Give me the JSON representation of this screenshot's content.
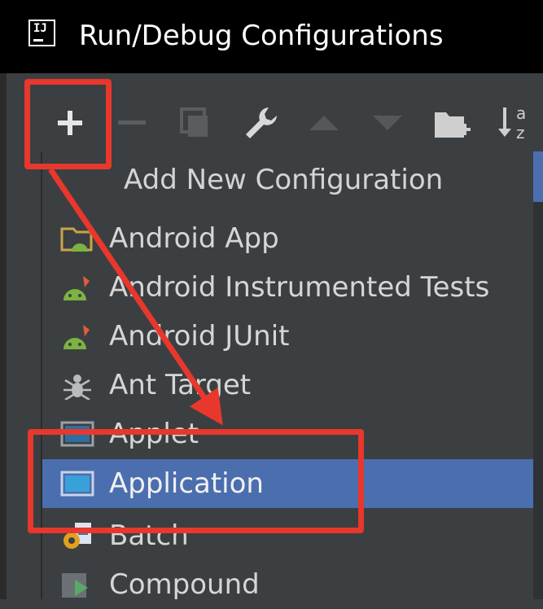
{
  "window": {
    "app_icon_text": "IJ",
    "title": "Run/Debug Configurations"
  },
  "toolbar": {
    "buttons": [
      {
        "name": "add",
        "icon": "plus-icon",
        "enabled": true
      },
      {
        "name": "remove",
        "icon": "minus-icon",
        "enabled": false
      },
      {
        "name": "copy",
        "icon": "copy-icon",
        "enabled": false
      },
      {
        "name": "edit-defaults",
        "icon": "wrench-icon",
        "enabled": true
      },
      {
        "name": "move-up",
        "icon": "arrow-up-icon",
        "enabled": false
      },
      {
        "name": "move-down",
        "icon": "arrow-down-icon",
        "enabled": false
      },
      {
        "name": "new-folder",
        "icon": "folder-add-icon",
        "enabled": true
      },
      {
        "name": "sort",
        "icon": "sort-az-icon",
        "enabled": true
      }
    ]
  },
  "menu": {
    "header": "Add New Configuration",
    "items": [
      {
        "label": "Android App",
        "icon": "android-app-icon"
      },
      {
        "label": "Android Instrumented Tests",
        "icon": "android-test-icon"
      },
      {
        "label": "Android JUnit",
        "icon": "android-junit-icon"
      },
      {
        "label": "Ant Target",
        "icon": "ant-icon"
      },
      {
        "label": "Applet",
        "icon": "applet-icon"
      },
      {
        "label": "Application",
        "icon": "application-icon",
        "selected": true
      },
      {
        "label": "Batch",
        "icon": "batch-icon"
      },
      {
        "label": "Compound",
        "icon": "compound-icon"
      }
    ]
  },
  "colors": {
    "accent": "#4b6eaf",
    "annotation": "#e8372c",
    "background": "#3c3f41",
    "android_green": "#7cb342"
  }
}
